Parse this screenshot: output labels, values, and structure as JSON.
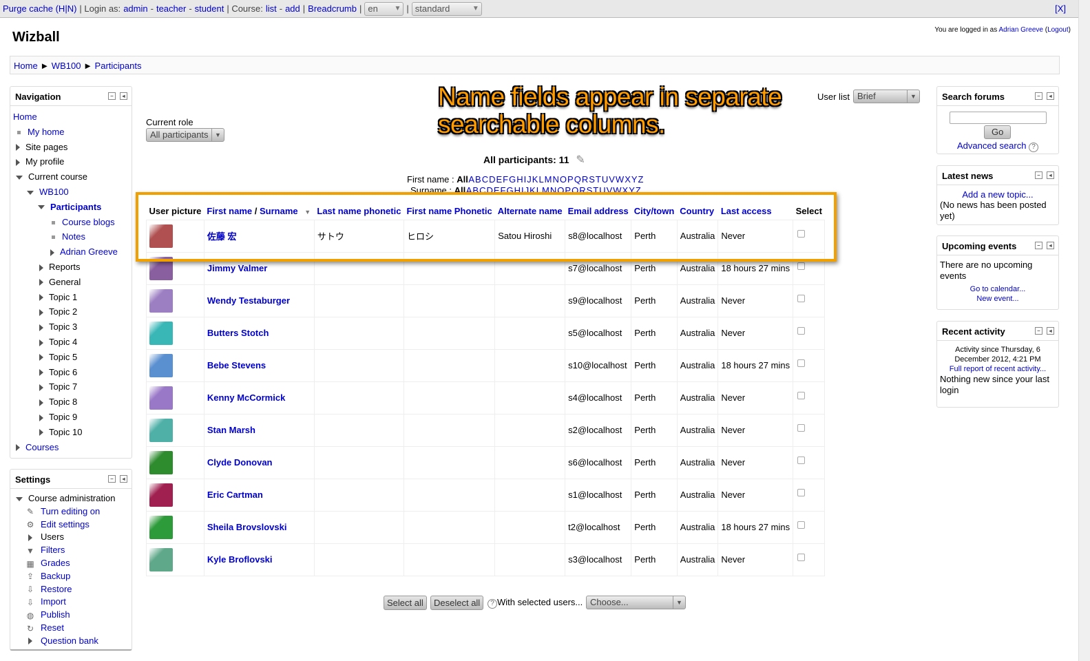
{
  "devbar": {
    "purge": "Purge cache (H|N)",
    "login_as_prefix": "| Login as:",
    "login_admin": "admin",
    "login_teacher": "teacher",
    "login_student": "student",
    "course_prefix": "| Course:",
    "course_list": "list",
    "course_add": "add",
    "breadcrumb": "Breadcrumb",
    "lang": "en",
    "theme": "standard",
    "close": "[X]"
  },
  "site": {
    "name": "Wizball",
    "logged_in_prefix": "You are logged in as",
    "user": "Adrian Greeve",
    "logout": "Logout"
  },
  "breadcrumbs": [
    "Home",
    "WB100",
    "Participants"
  ],
  "navigation": {
    "title": "Navigation",
    "items": [
      {
        "label": "Home"
      },
      {
        "label": "My home"
      },
      {
        "label": "Site pages"
      },
      {
        "label": "My profile"
      },
      {
        "label": "Current course"
      },
      {
        "label": "WB100"
      },
      {
        "label": "Participants"
      },
      {
        "label": "Course blogs"
      },
      {
        "label": "Notes"
      },
      {
        "label": "Adrian Greeve"
      },
      {
        "label": "Reports"
      },
      {
        "label": "General"
      },
      {
        "label": "Topic 1"
      },
      {
        "label": "Topic 2"
      },
      {
        "label": "Topic 3"
      },
      {
        "label": "Topic 4"
      },
      {
        "label": "Topic 5"
      },
      {
        "label": "Topic 6"
      },
      {
        "label": "Topic 7"
      },
      {
        "label": "Topic 8"
      },
      {
        "label": "Topic 9"
      },
      {
        "label": "Topic 10"
      },
      {
        "label": "Courses"
      }
    ]
  },
  "settings": {
    "title": "Settings",
    "items": [
      {
        "label": "Course administration"
      },
      {
        "label": "Turn editing on",
        "icon": "pencil-icon"
      },
      {
        "label": "Edit settings",
        "icon": "gear-icon"
      },
      {
        "label": "Users"
      },
      {
        "label": "Filters",
        "icon": "filter-icon"
      },
      {
        "label": "Grades",
        "icon": "grades-icon"
      },
      {
        "label": "Backup",
        "icon": "backup-icon"
      },
      {
        "label": "Restore",
        "icon": "restore-icon"
      },
      {
        "label": "Import",
        "icon": "import-icon"
      },
      {
        "label": "Publish",
        "icon": "publish-icon"
      },
      {
        "label": "Reset",
        "icon": "reset-icon"
      },
      {
        "label": "Question bank"
      }
    ]
  },
  "main": {
    "current_role_label": "Current role",
    "current_role_value": "All participants",
    "annotation_line1": "Name fields appear in separate",
    "annotation_line2": "searchable columns.",
    "user_list_label": "User list",
    "user_list_value": "Brief",
    "all_participants": "All participants: 11",
    "firstname_label": "First name :",
    "surname_label": "Surname :",
    "all_label": "All",
    "letters": [
      "A",
      "B",
      "C",
      "D",
      "E",
      "F",
      "G",
      "H",
      "I",
      "J",
      "K",
      "L",
      "M",
      "N",
      "O",
      "P",
      "Q",
      "R",
      "S",
      "T",
      "U",
      "V",
      "W",
      "X",
      "Y",
      "Z"
    ],
    "columns": {
      "picture": "User picture",
      "firstname": "First name",
      "slash": "/",
      "surname": "Surname",
      "lastphonetic": "Last name phonetic",
      "firstphonetic": "First name Phonetic",
      "alternate": "Alternate name",
      "email": "Email address",
      "city": "City/town",
      "country": "Country",
      "lastaccess": "Last access",
      "select": "Select"
    },
    "rows": [
      {
        "name": "佐藤 宏",
        "lastphonetic": "サトウ",
        "firstphonetic": "ヒロシ",
        "alternate": "Satou Hiroshi",
        "email": "s8@localhost",
        "city": "Perth",
        "country": "Australia",
        "access": "Never",
        "avatar_color": "#b05050"
      },
      {
        "name": "Jimmy Valmer",
        "lastphonetic": "",
        "firstphonetic": "",
        "alternate": "",
        "email": "s7@localhost",
        "city": "Perth",
        "country": "Australia",
        "access": "18 hours 27 mins",
        "avatar_color": "#8a5fa0"
      },
      {
        "name": "Wendy Testaburger",
        "lastphonetic": "",
        "firstphonetic": "",
        "alternate": "",
        "email": "s9@localhost",
        "city": "Perth",
        "country": "Australia",
        "access": "Never",
        "avatar_color": "#9c7ec2"
      },
      {
        "name": "Butters Stotch",
        "lastphonetic": "",
        "firstphonetic": "",
        "alternate": "",
        "email": "s5@localhost",
        "city": "Perth",
        "country": "Australia",
        "access": "Never",
        "avatar_color": "#39b6b6"
      },
      {
        "name": "Bebe Stevens",
        "lastphonetic": "",
        "firstphonetic": "",
        "alternate": "",
        "email": "s10@localhost",
        "city": "Perth",
        "country": "Australia",
        "access": "18 hours 27 mins",
        "avatar_color": "#5a8fd0"
      },
      {
        "name": "Kenny McCormick",
        "lastphonetic": "",
        "firstphonetic": "",
        "alternate": "",
        "email": "s4@localhost",
        "city": "Perth",
        "country": "Australia",
        "access": "Never",
        "avatar_color": "#9a78c8"
      },
      {
        "name": "Stan Marsh",
        "lastphonetic": "",
        "firstphonetic": "",
        "alternate": "",
        "email": "s2@localhost",
        "city": "Perth",
        "country": "Australia",
        "access": "Never",
        "avatar_color": "#4fb0a8"
      },
      {
        "name": "Clyde Donovan",
        "lastphonetic": "",
        "firstphonetic": "",
        "alternate": "",
        "email": "s6@localhost",
        "city": "Perth",
        "country": "Australia",
        "access": "Never",
        "avatar_color": "#2e8b2e"
      },
      {
        "name": "Eric Cartman",
        "lastphonetic": "",
        "firstphonetic": "",
        "alternate": "",
        "email": "s1@localhost",
        "city": "Perth",
        "country": "Australia",
        "access": "Never",
        "avatar_color": "#a02050"
      },
      {
        "name": "Sheila Brovslovski",
        "lastphonetic": "",
        "firstphonetic": "",
        "alternate": "",
        "email": "t2@localhost",
        "city": "Perth",
        "country": "Australia",
        "access": "18 hours 27 mins",
        "avatar_color": "#2e9b3a"
      },
      {
        "name": "Kyle Broflovski",
        "lastphonetic": "",
        "firstphonetic": "",
        "alternate": "",
        "email": "s3@localhost",
        "city": "Perth",
        "country": "Australia",
        "access": "Never",
        "avatar_color": "#5fa88a"
      }
    ],
    "select_all": "Select all",
    "deselect_all": "Deselect all",
    "with_selected": "With selected users...",
    "choose": "Choose..."
  },
  "right": {
    "search_title": "Search forums",
    "go": "Go",
    "advanced_search": "Advanced search",
    "news_title": "Latest news",
    "add_topic": "Add a new topic...",
    "no_news": "(No news has been posted yet)",
    "events_title": "Upcoming events",
    "no_events": "There are no upcoming events",
    "goto_calendar": "Go to calendar...",
    "new_event": "New event...",
    "activity_title": "Recent activity",
    "activity_since": "Activity since Thursday, 6 December 2012, 4:21 PM",
    "full_report": "Full report of recent activity...",
    "nothing_new": "Nothing new since your last login"
  }
}
